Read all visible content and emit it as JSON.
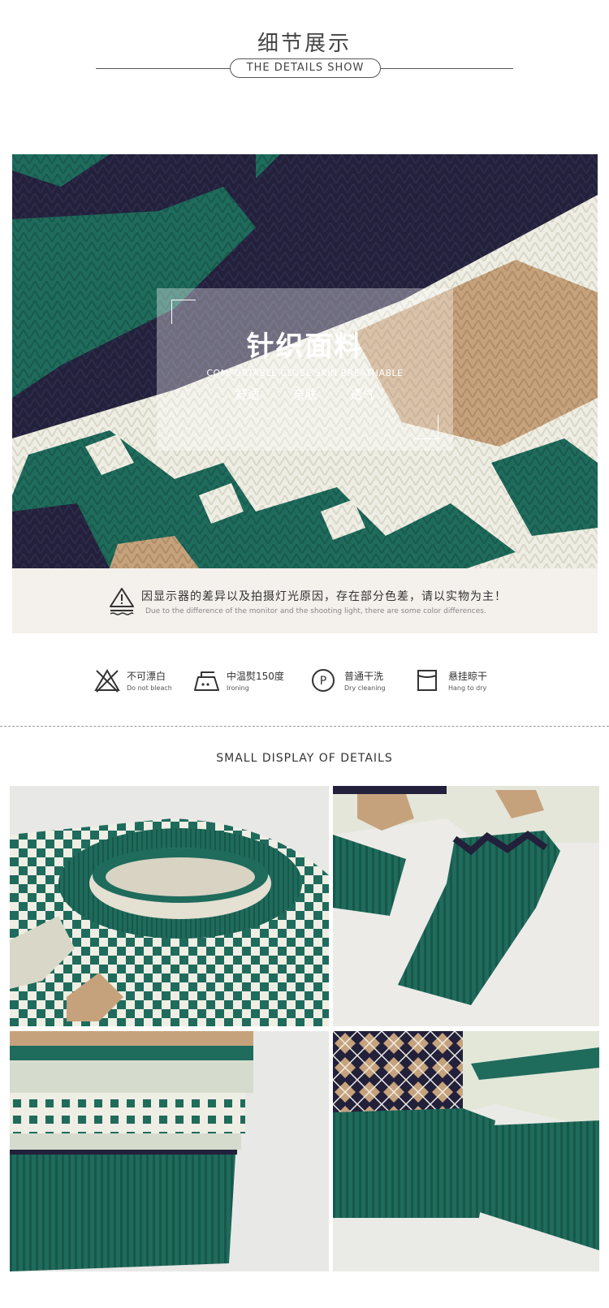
{
  "header": {
    "title_cn": "细节展示",
    "title_en": "THE DETAILS SHOW"
  },
  "fabric": {
    "title": "针织面料",
    "subtitle": "COMFORTABLE CLOSE SKIN BREATHABLE",
    "tags": [
      "舒适",
      "亲肤",
      "透气"
    ]
  },
  "notice": {
    "cn": "因显示器的差异以及拍摄灯光原因，存在部分色差，请以实物为主！",
    "en": "Due to the difference of the monitor and the shooting light, there are some color differences."
  },
  "care": [
    {
      "icon": "no-bleach-icon",
      "cn": "不可漂白",
      "en": "Do not bleach"
    },
    {
      "icon": "iron-icon",
      "cn": "中温熨150度",
      "en": "Ironing"
    },
    {
      "icon": "dry-clean-icon",
      "cn": "普通干洗",
      "en": "Dry cleaning"
    },
    {
      "icon": "hang-dry-icon",
      "cn": "悬挂晾干",
      "en": "Hang to dry"
    }
  ],
  "details": {
    "title": "SMALL DISPLAY OF DETAILS",
    "photos": [
      "collar-photo",
      "cuff-photo",
      "hem-photo",
      "hem-side-photo"
    ]
  },
  "colors": {
    "green": "#1f6b5c",
    "navy": "#22203a",
    "cream": "#efeee4",
    "tan": "#c6a27c",
    "panel": "#f4f0ec"
  }
}
